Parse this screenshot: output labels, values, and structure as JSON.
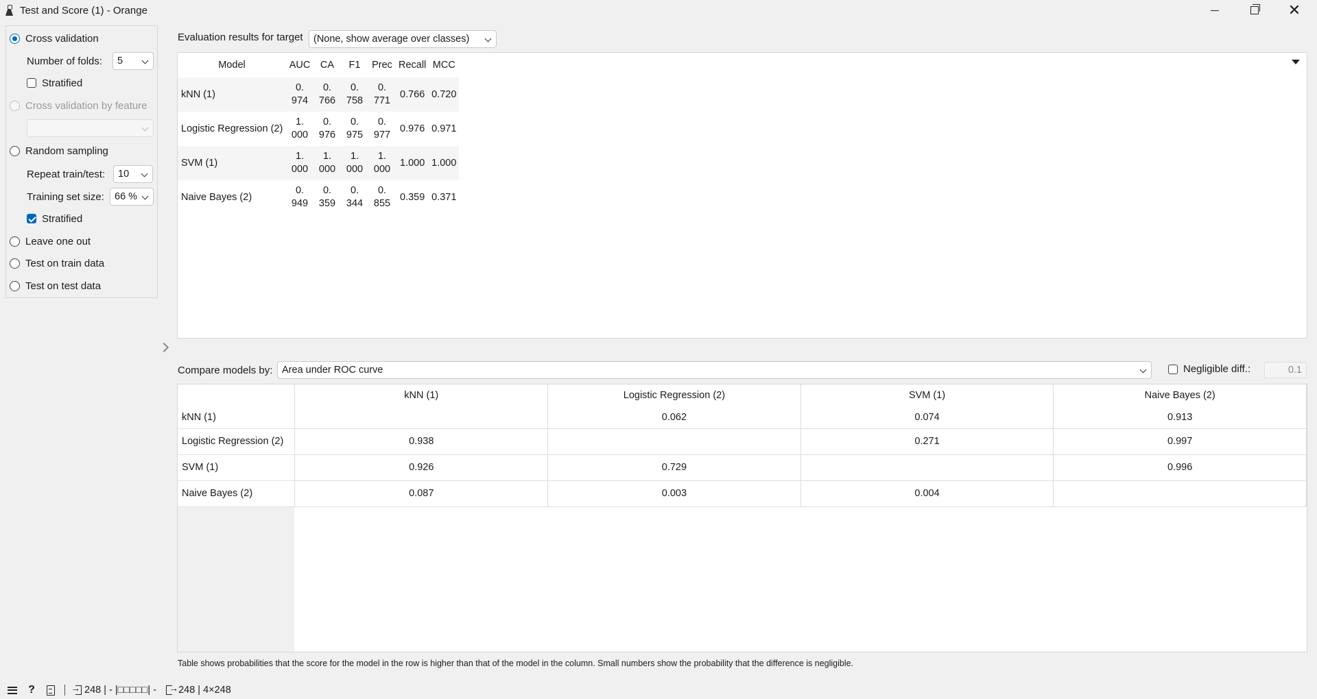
{
  "window": {
    "title": "Test and Score (1) - Orange"
  },
  "sampling": {
    "cross_validation": "Cross validation",
    "number_of_folds_label": "Number of folds:",
    "number_of_folds_value": "5",
    "stratified_cv": "Stratified",
    "cv_by_feature": "Cross validation by feature",
    "cv_by_feature_value": "",
    "random_sampling": "Random sampling",
    "repeat_label": "Repeat train/test:",
    "repeat_value": "10",
    "training_size_label": "Training set size:",
    "training_size_value": "66 %",
    "stratified_rs": "Stratified",
    "leave_one_out": "Leave one out",
    "test_on_train": "Test on train data",
    "test_on_test": "Test on test data"
  },
  "evaluation": {
    "target_label": "Evaluation results for target",
    "target_value": "(None, show average over classes)",
    "columns": [
      "Model",
      "AUC",
      "CA",
      "F1",
      "Prec",
      "Recall",
      "MCC"
    ],
    "rows": [
      {
        "model": "kNN (1)",
        "auc": "0.\n974",
        "ca": "0.\n766",
        "f1": "0.\n758",
        "prec": "0.\n771",
        "recall": "0.766",
        "mcc": "0.720"
      },
      {
        "model": "Logistic Regression (2)",
        "auc": "1.\n000",
        "ca": "0.\n976",
        "f1": "0.\n975",
        "prec": "0.\n977",
        "recall": "0.976",
        "mcc": "0.971"
      },
      {
        "model": "SVM (1)",
        "auc": "1.\n000",
        "ca": "1.\n000",
        "f1": "1.\n000",
        "prec": "1.\n000",
        "recall": "1.000",
        "mcc": "1.000"
      },
      {
        "model": "Naive Bayes (2)",
        "auc": "0.\n949",
        "ca": "0.\n359",
        "f1": "0.\n344",
        "prec": "0.\n855",
        "recall": "0.359",
        "mcc": "0.371"
      }
    ]
  },
  "compare": {
    "label": "Compare models by:",
    "value": "Area under ROC curve",
    "negligible_label": "Negligible diff.:",
    "negligible_value": "0.1",
    "columns": [
      "kNN (1)",
      "Logistic Regression (2)",
      "SVM (1)",
      "Naive Bayes (2)"
    ],
    "rows": [
      {
        "name": "kNN (1)",
        "cells": [
          "",
          "0.062",
          "0.074",
          "0.913"
        ]
      },
      {
        "name": "Logistic Regression (2)",
        "cells": [
          "0.938",
          "",
          "0.271",
          "0.997"
        ]
      },
      {
        "name": "SVM (1)",
        "cells": [
          "0.926",
          "0.729",
          "",
          "0.996"
        ]
      },
      {
        "name": "Naive Bayes (2)",
        "cells": [
          "0.087",
          "0.003",
          "0.004",
          ""
        ]
      }
    ],
    "footnote": "Table shows probabilities that the score for the model in the row is higher than that of the model in the column. Small numbers show the probability that the difference is negligible."
  },
  "status": {
    "help": "?",
    "input_summary": "248 | - |□□□□□| -",
    "output_summary": "248 | 4×248"
  },
  "colors": {
    "accent": "#0067c0",
    "background": "#f0f0f0",
    "alt_row": "#f5f5f5"
  }
}
